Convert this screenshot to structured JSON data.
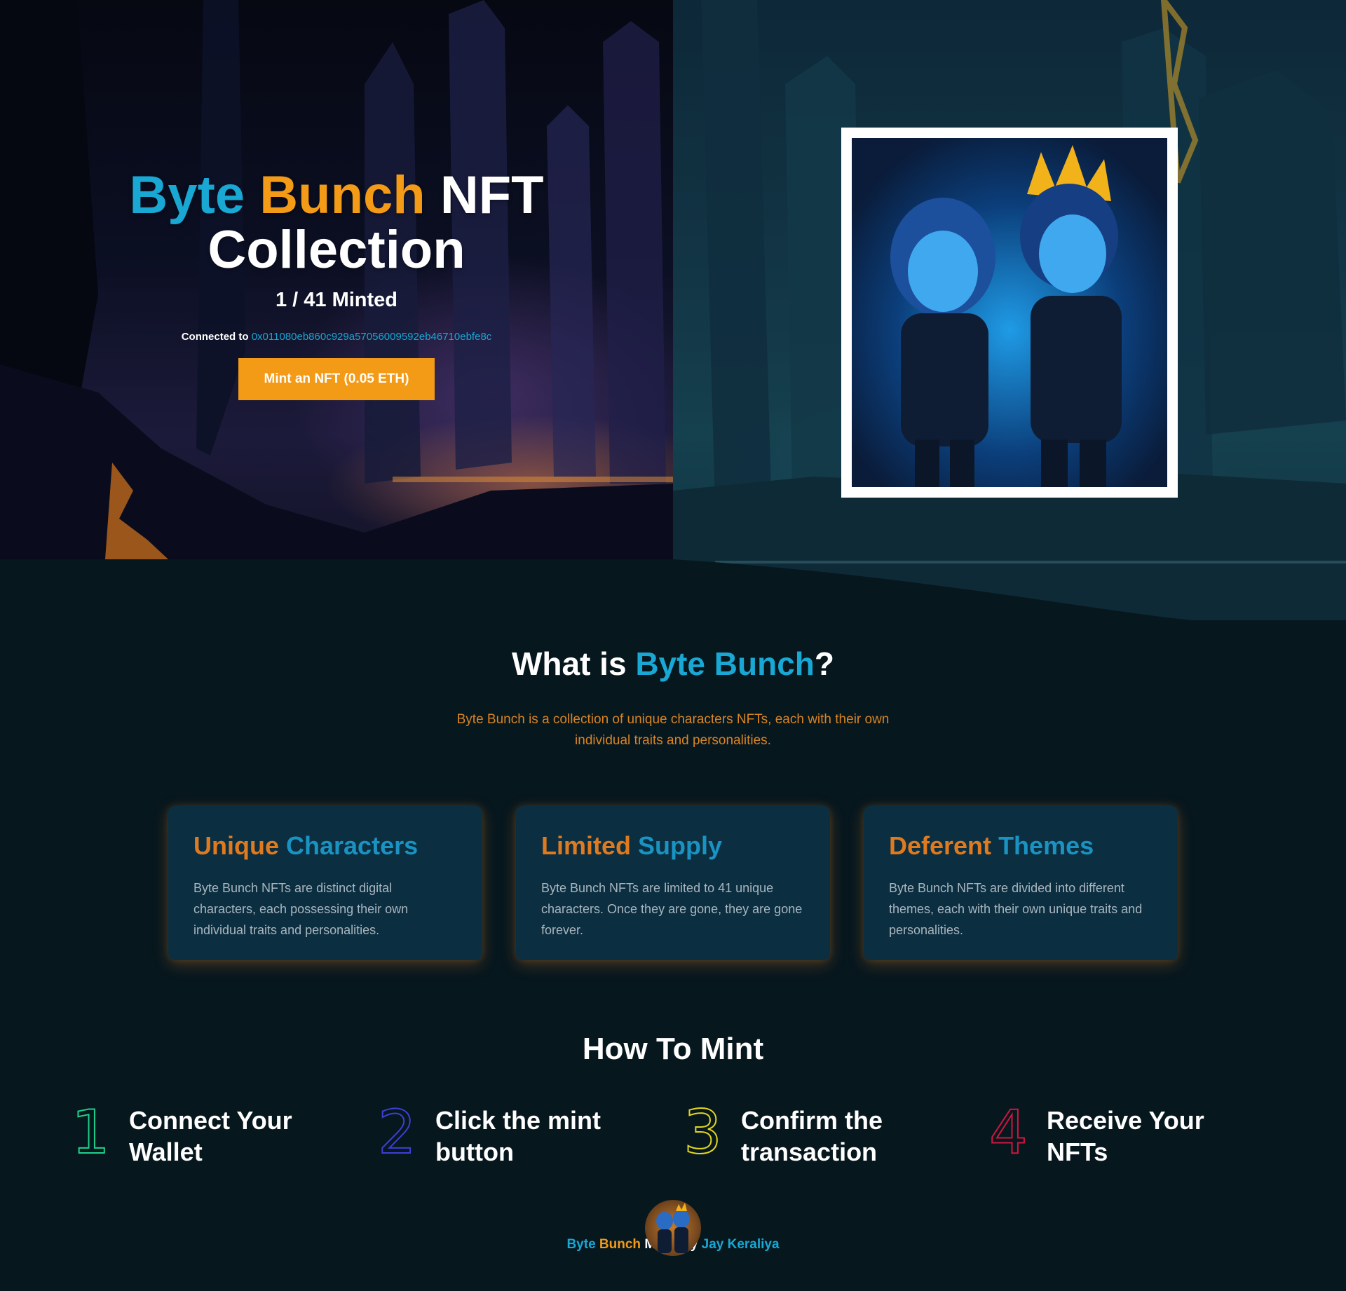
{
  "hero": {
    "title_word1": "Byte",
    "title_word2": "Bunch",
    "title_word3": "NFT",
    "title_word4": "Collection",
    "minted_text": "1 / 41 Minted",
    "connected_label": "Connected to",
    "wallet_address": "0x011080eb860c929a57056009592eb46710ebfe8c",
    "mint_button_label": "Mint an NFT (0.05 ETH)"
  },
  "about": {
    "title_prefix": "What is",
    "title_highlight": "Byte Bunch",
    "title_suffix": "?",
    "description": "Byte Bunch is a collection of unique characters NFTs, each with their own individual traits and personalities."
  },
  "features": [
    {
      "title_part1": "Unique",
      "title_part2": "Characters",
      "text": "Byte Bunch NFTs are distinct digital characters, each possessing their own individual traits and personalities."
    },
    {
      "title_part1": "Limited",
      "title_part2": "Supply",
      "text": "Byte Bunch NFTs are limited to 41 unique characters. Once they are gone, they are gone forever."
    },
    {
      "title_part1": "Deferent",
      "title_part2": "Themes",
      "text": "Byte Bunch NFTs are divided into different themes, each with their own unique traits and personalities."
    }
  ],
  "how_to_mint": {
    "title": "How To Mint",
    "steps": [
      {
        "number": "1",
        "label": "Connect Your Wallet",
        "color": "#1dd18c"
      },
      {
        "number": "2",
        "label": "Click the mint button",
        "color": "#3d3fd6"
      },
      {
        "number": "3",
        "label": "Confirm the transaction",
        "color": "#e3d61f"
      },
      {
        "number": "4",
        "label": "Receive Your NFTs",
        "color": "#d2163f"
      }
    ]
  },
  "footer": {
    "part1": "Byte",
    "part2": "Bunch",
    "part3": "Made by",
    "part4": "Jay Keraliya"
  },
  "colors": {
    "accent_cyan": "#19a7d4",
    "accent_orange": "#f39a17",
    "background": "#07171e",
    "card_background": "#0b2e40"
  }
}
